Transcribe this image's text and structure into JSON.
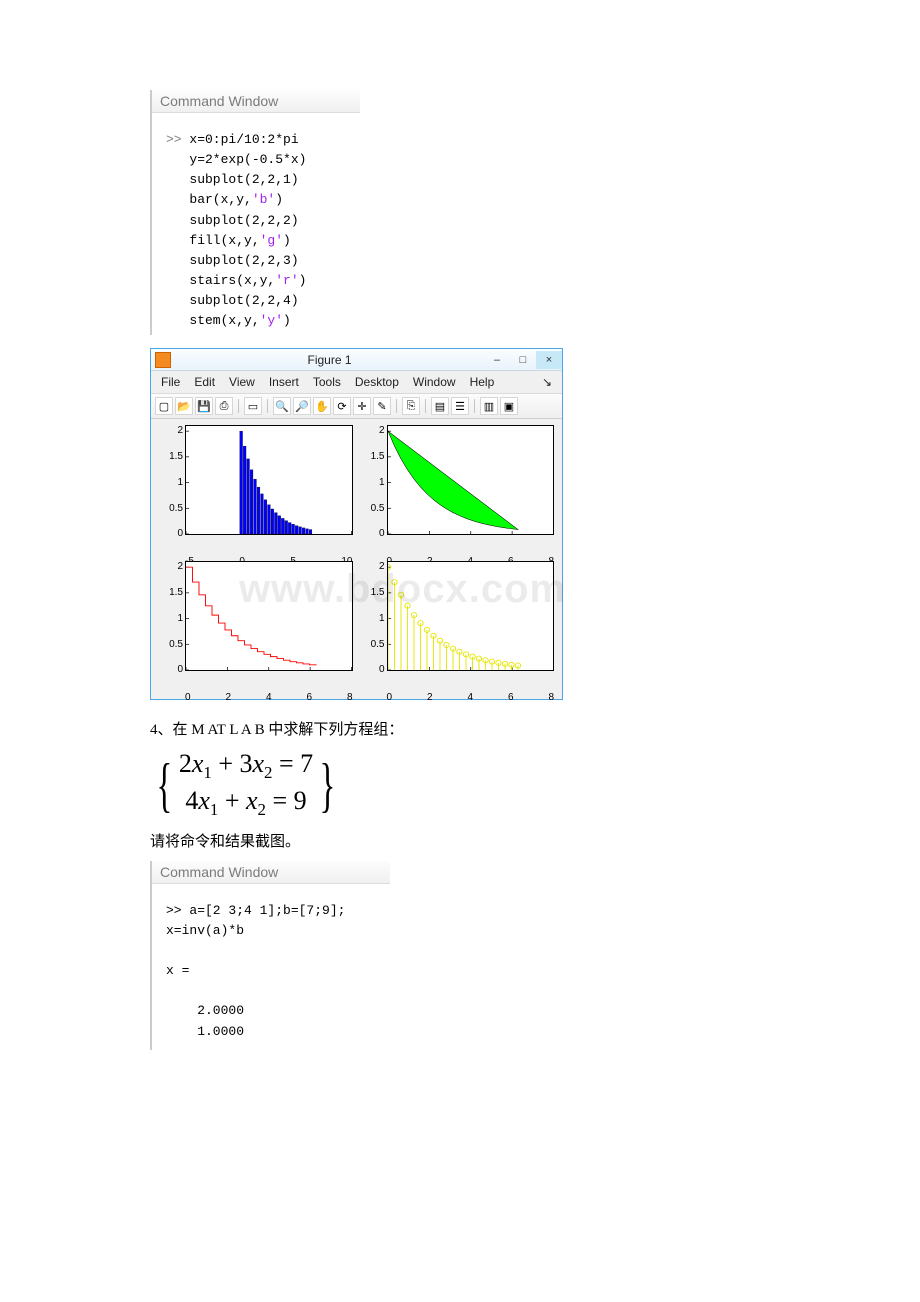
{
  "cmd1": {
    "title": "Command Window",
    "lines": [
      {
        "cls": "prompt",
        "t": ">> "
      },
      {
        "cls": "code-black",
        "t": "x=0:pi/10:2*pi\n"
      },
      {
        "cls": "code-black",
        "t": "y=2*exp(-0.5*x)\n"
      },
      {
        "cls": "code-black",
        "t": "subplot(2,2,1)\n"
      },
      {
        "cls": "code-black",
        "t": "bar(x,y,"
      },
      {
        "cls": "code-purple",
        "t": "'b'"
      },
      {
        "cls": "code-black",
        "t": ")\n"
      },
      {
        "cls": "code-black",
        "t": "subplot(2,2,2)\n"
      },
      {
        "cls": "code-black",
        "t": "fill(x,y,"
      },
      {
        "cls": "code-purple",
        "t": "'g'"
      },
      {
        "cls": "code-black",
        "t": ")\n"
      },
      {
        "cls": "code-black",
        "t": "subplot(2,2,3)\n"
      },
      {
        "cls": "code-black",
        "t": "stairs(x,y,"
      },
      {
        "cls": "code-purple",
        "t": "'r'"
      },
      {
        "cls": "code-black",
        "t": ")\n"
      },
      {
        "cls": "code-black",
        "t": "subplot(2,2,4)\n"
      },
      {
        "cls": "code-black",
        "t": "stem(x,y,"
      },
      {
        "cls": "code-purple",
        "t": "'y'"
      },
      {
        "cls": "code-black",
        "t": ")"
      }
    ]
  },
  "figure": {
    "title": "Figure 1",
    "menus": [
      "File",
      "Edit",
      "View",
      "Insert",
      "Tools",
      "Desktop",
      "Window",
      "Help"
    ]
  },
  "chart_data": [
    {
      "type": "bar",
      "color": "#0000ff",
      "x": [
        0,
        0.314,
        0.628,
        0.942,
        1.257,
        1.571,
        1.885,
        2.199,
        2.513,
        2.827,
        3.142,
        3.456,
        3.77,
        4.084,
        4.398,
        4.712,
        5.027,
        5.341,
        5.655,
        5.969,
        6.283
      ],
      "values": [
        2.0,
        1.709,
        1.461,
        1.249,
        1.067,
        0.912,
        0.78,
        0.666,
        0.569,
        0.487,
        0.416,
        0.356,
        0.304,
        0.26,
        0.222,
        0.19,
        0.162,
        0.139,
        0.119,
        0.101,
        0.087
      ],
      "xticks": [
        -5,
        0,
        5,
        10
      ],
      "yticks": [
        0,
        0.5,
        1,
        1.5,
        2
      ],
      "xlim": [
        -5,
        10
      ],
      "ylim": [
        0,
        2.1
      ]
    },
    {
      "type": "area",
      "color": "#00ff00",
      "x": [
        0,
        0.314,
        0.628,
        0.942,
        1.257,
        1.571,
        1.885,
        2.199,
        2.513,
        2.827,
        3.142,
        3.456,
        3.77,
        4.084,
        4.398,
        4.712,
        5.027,
        5.341,
        5.655,
        5.969,
        6.283
      ],
      "values": [
        2.0,
        1.709,
        1.461,
        1.249,
        1.067,
        0.912,
        0.78,
        0.666,
        0.569,
        0.487,
        0.416,
        0.356,
        0.304,
        0.26,
        0.222,
        0.19,
        0.162,
        0.139,
        0.119,
        0.101,
        0.087
      ],
      "xticks": [
        0,
        2,
        4,
        6,
        8
      ],
      "yticks": [
        0,
        0.5,
        1,
        1.5,
        2
      ],
      "xlim": [
        0,
        8
      ],
      "ylim": [
        0,
        2.1
      ]
    },
    {
      "type": "stairs",
      "color": "#ff0000",
      "x": [
        0,
        0.314,
        0.628,
        0.942,
        1.257,
        1.571,
        1.885,
        2.199,
        2.513,
        2.827,
        3.142,
        3.456,
        3.77,
        4.084,
        4.398,
        4.712,
        5.027,
        5.341,
        5.655,
        5.969,
        6.283
      ],
      "values": [
        2.0,
        1.709,
        1.461,
        1.249,
        1.067,
        0.912,
        0.78,
        0.666,
        0.569,
        0.487,
        0.416,
        0.356,
        0.304,
        0.26,
        0.222,
        0.19,
        0.162,
        0.139,
        0.119,
        0.101,
        0.087
      ],
      "xticks": [
        0,
        2,
        4,
        6,
        8
      ],
      "yticks": [
        0,
        0.5,
        1,
        1.5,
        2
      ],
      "xlim": [
        0,
        8
      ],
      "ylim": [
        0,
        2.1
      ]
    },
    {
      "type": "stem",
      "color": "#e6e600",
      "x": [
        0,
        0.314,
        0.628,
        0.942,
        1.257,
        1.571,
        1.885,
        2.199,
        2.513,
        2.827,
        3.142,
        3.456,
        3.77,
        4.084,
        4.398,
        4.712,
        5.027,
        5.341,
        5.655,
        5.969,
        6.283
      ],
      "values": [
        2.0,
        1.709,
        1.461,
        1.249,
        1.067,
        0.912,
        0.78,
        0.666,
        0.569,
        0.487,
        0.416,
        0.356,
        0.304,
        0.26,
        0.222,
        0.19,
        0.162,
        0.139,
        0.119,
        0.101,
        0.087
      ],
      "xticks": [
        0,
        2,
        4,
        6,
        8
      ],
      "yticks": [
        0,
        0.5,
        1,
        1.5,
        2
      ],
      "xlim": [
        0,
        8
      ],
      "ylim": [
        0,
        2.1
      ]
    }
  ],
  "watermark": "www.bdocx.com",
  "q4": {
    "title": "4、在 M AT L A B 中求解下列方程组：",
    "eq1": "2x₁ + 3x₂ = 7",
    "eq2": "4x₁ + x₂ = 9",
    "caption": "请将命令和结果截图。"
  },
  "cmd2": {
    "title": "Command Window",
    "code": ">> a=[2 3;4 1];b=[7;9];\nx=inv(a)*b\n\nx =\n\n    2.0000\n    1.0000"
  }
}
